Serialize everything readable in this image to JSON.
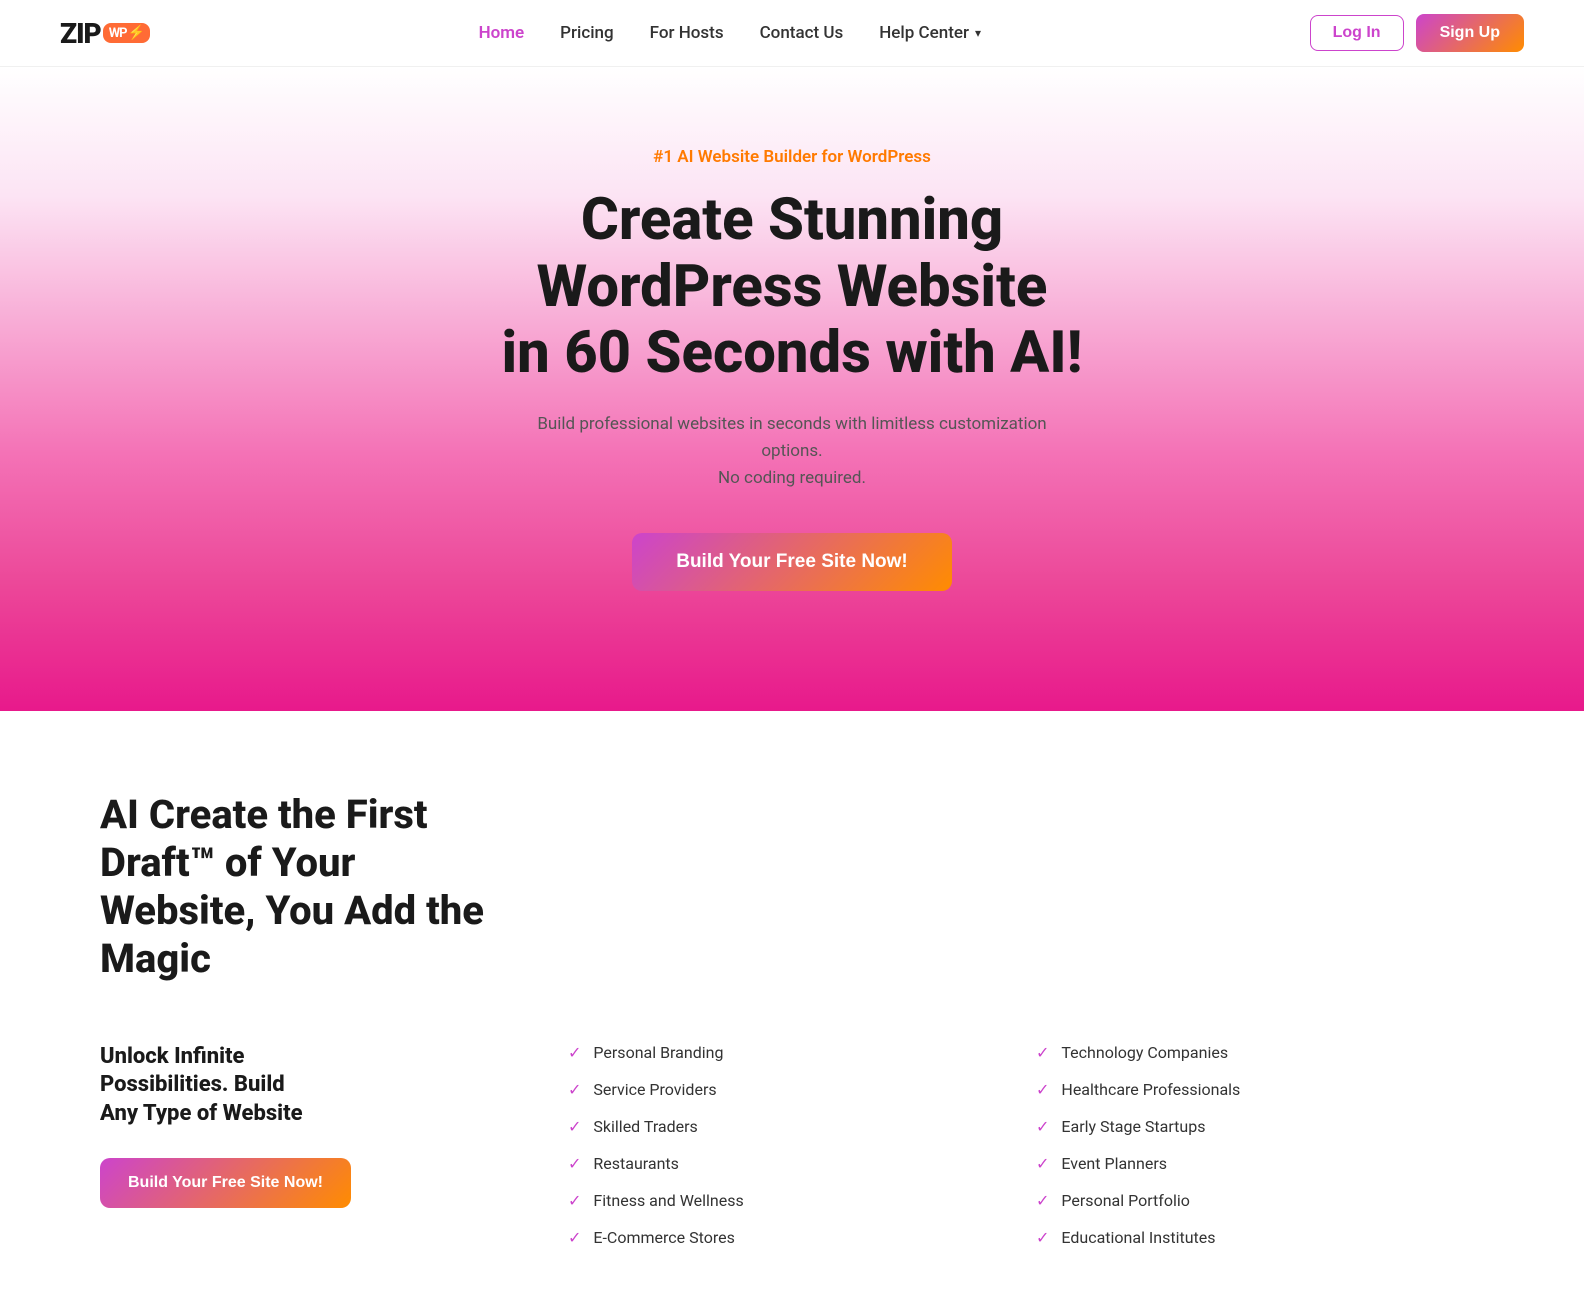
{
  "brand": {
    "name_zip": "ZIP",
    "name_badge": "WP",
    "lightning": "⚡"
  },
  "nav": {
    "links": [
      {
        "id": "home",
        "label": "Home",
        "active": true
      },
      {
        "id": "pricing",
        "label": "Pricing",
        "active": false
      },
      {
        "id": "for-hosts",
        "label": "For Hosts",
        "active": false
      },
      {
        "id": "contact-us",
        "label": "Contact Us",
        "active": false
      },
      {
        "id": "help-center",
        "label": "Help Center",
        "active": false
      }
    ],
    "login_label": "Log In",
    "signup_label": "Sign Up"
  },
  "hero": {
    "tagline": "#1 AI Website Builder for WordPress",
    "title_line1": "Create Stunning WordPress Website",
    "title_line2": "in 60 Seconds with AI!",
    "subtitle_line1": "Build professional websites in seconds with limitless customization options.",
    "subtitle_line2": "No coding required.",
    "cta_label": "Build Your Free Site Now!"
  },
  "features": {
    "section_title_line1": "AI Create the First Draft™ of Your",
    "section_title_line2": "Website, You Add the Magic",
    "left_title_line1": "Unlock Infinite",
    "left_title_line2": "Possibilities. Build",
    "left_title_line3": "Any Type of Website",
    "cta_label": "Build Your Free Site Now!",
    "list_col1": [
      "Personal Branding",
      "Service Providers",
      "Skilled Traders",
      "Restaurants",
      "Fitness and Wellness",
      "E-Commerce Stores"
    ],
    "list_col2": [
      "Technology Companies",
      "Healthcare Professionals",
      "Early Stage Startups",
      "Event Planners",
      "Personal Portfolio",
      "Educational Institutes"
    ]
  },
  "colors": {
    "accent": "#cc44cc",
    "orange": "#ff8c00",
    "tagline_orange": "#ff7a00"
  }
}
